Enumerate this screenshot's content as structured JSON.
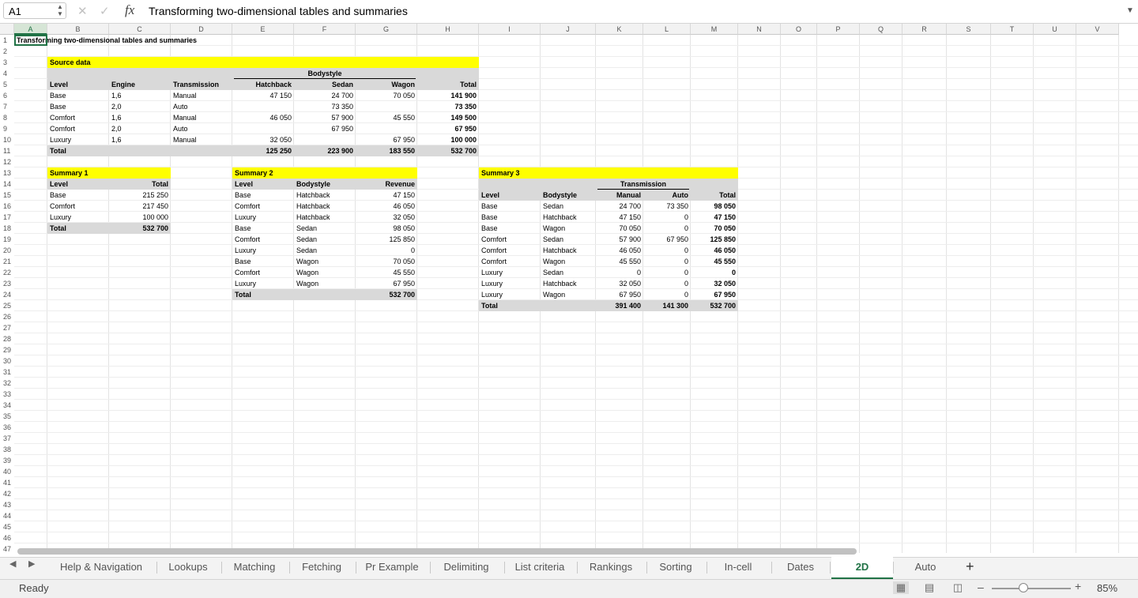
{
  "formula_bar": {
    "name_box": "A1",
    "fx": "fx",
    "formula": "Transforming two-dimensional tables and summaries"
  },
  "columns": [
    "A",
    "B",
    "C",
    "D",
    "E",
    "F",
    "G",
    "H",
    "I",
    "J",
    "K",
    "L",
    "M",
    "N",
    "O",
    "P",
    "Q",
    "R",
    "S",
    "T",
    "U",
    "V"
  ],
  "rows": [
    "1",
    "2",
    "3",
    "4",
    "5",
    "6",
    "7",
    "8",
    "9",
    "10",
    "11",
    "12",
    "13",
    "14",
    "15",
    "16",
    "17",
    "18",
    "19",
    "20",
    "21",
    "22",
    "23",
    "24",
    "25",
    "26",
    "27",
    "28",
    "29",
    "30",
    "31",
    "32",
    "33",
    "34",
    "35",
    "36",
    "37",
    "38",
    "39",
    "40",
    "41",
    "42",
    "43",
    "44",
    "45",
    "46",
    "47"
  ],
  "sheet": {
    "title": "Transforming two-dimensional tables and summaries",
    "source": {
      "heading": "Source data",
      "group_header": "Bodystyle",
      "headers": [
        "Level",
        "Engine",
        "Transmission",
        "Hatchback",
        "Sedan",
        "Wagon",
        "Total"
      ],
      "rows": [
        [
          "Base",
          "1,6",
          "Manual",
          "47 150",
          "24 700",
          "70 050",
          "141 900"
        ],
        [
          "Base",
          "2,0",
          "Auto",
          "",
          "73 350",
          "",
          "73 350"
        ],
        [
          "Comfort",
          "1,6",
          "Manual",
          "46 050",
          "57 900",
          "45 550",
          "149 500"
        ],
        [
          "Comfort",
          "2,0",
          "Auto",
          "",
          "67 950",
          "",
          "67 950"
        ],
        [
          "Luxury",
          "1,6",
          "Manual",
          "32 050",
          "",
          "67 950",
          "100 000"
        ]
      ],
      "total": [
        "Total",
        "",
        "",
        "125 250",
        "223 900",
        "183 550",
        "532 700"
      ]
    },
    "summary1": {
      "heading": "Summary 1",
      "headers": [
        "Level",
        "Total"
      ],
      "rows": [
        [
          "Base",
          "215 250"
        ],
        [
          "Comfort",
          "217 450"
        ],
        [
          "Luxury",
          "100 000"
        ]
      ],
      "total": [
        "Total",
        "532 700"
      ]
    },
    "summary2": {
      "heading": "Summary 2",
      "headers": [
        "Level",
        "Bodystyle",
        "Revenue"
      ],
      "rows": [
        [
          "Base",
          "Hatchback",
          "47 150"
        ],
        [
          "Comfort",
          "Hatchback",
          "46 050"
        ],
        [
          "Luxury",
          "Hatchback",
          "32 050"
        ],
        [
          "Base",
          "Sedan",
          "98 050"
        ],
        [
          "Comfort",
          "Sedan",
          "125 850"
        ],
        [
          "Luxury",
          "Sedan",
          "0"
        ],
        [
          "Base",
          "Wagon",
          "70 050"
        ],
        [
          "Comfort",
          "Wagon",
          "45 550"
        ],
        [
          "Luxury",
          "Wagon",
          "67 950"
        ]
      ],
      "total": [
        "Total",
        "",
        "532 700"
      ]
    },
    "summary3": {
      "heading": "Summary 3",
      "group_header": "Transmission",
      "headers": [
        "Level",
        "Bodystyle",
        "Manual",
        "Auto",
        "Total"
      ],
      "rows": [
        [
          "Base",
          "Sedan",
          "24 700",
          "73 350",
          "98 050"
        ],
        [
          "Base",
          "Hatchback",
          "47 150",
          "0",
          "47 150"
        ],
        [
          "Base",
          "Wagon",
          "70 050",
          "0",
          "70 050"
        ],
        [
          "Comfort",
          "Sedan",
          "57 900",
          "67 950",
          "125 850"
        ],
        [
          "Comfort",
          "Hatchback",
          "46 050",
          "0",
          "46 050"
        ],
        [
          "Comfort",
          "Wagon",
          "45 550",
          "0",
          "45 550"
        ],
        [
          "Luxury",
          "Sedan",
          "0",
          "0",
          "0"
        ],
        [
          "Luxury",
          "Hatchback",
          "32 050",
          "0",
          "32 050"
        ],
        [
          "Luxury",
          "Wagon",
          "67 950",
          "0",
          "67 950"
        ]
      ],
      "total": [
        "Total",
        "",
        "391 400",
        "141 300",
        "532 700"
      ]
    }
  },
  "tabs": [
    "Help & Navigation",
    "Lookups",
    "Matching",
    "Fetching",
    "Pr Example",
    "Delimiting",
    "List criteria",
    "Rankings",
    "Sorting",
    "In-cell",
    "Dates",
    "2D",
    "Auto"
  ],
  "active_tab": "2D",
  "status": {
    "text": "Ready",
    "zoom": "85%",
    "zoom_fraction": 0.4
  },
  "colors": {
    "accent": "#217346",
    "highlight_yellow": "#ffff00",
    "total_gray": "#d9d9d9"
  }
}
